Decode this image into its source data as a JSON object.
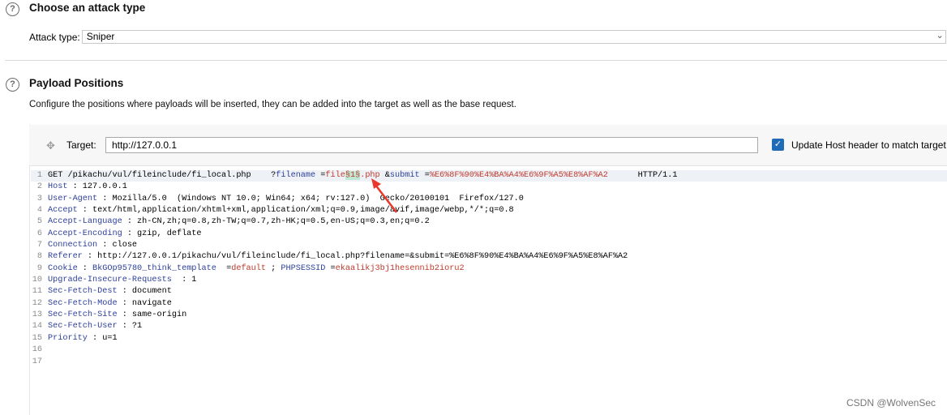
{
  "attack_section": {
    "title": "Choose an attack type",
    "attack_type_label": "Attack type:",
    "attack_type_value": "Sniper"
  },
  "payload_section": {
    "title": "Payload Positions",
    "description": "Configure the positions where payloads will be inserted, they can be added into the target as well as the base request."
  },
  "target": {
    "label": "Target:",
    "value": "http://127.0.0.1",
    "update_host_label": "Update Host header to match target",
    "update_host_checked": true
  },
  "request_lines": [
    {
      "n": "1",
      "parts": [
        {
          "t": "GET /pikachu/vul/fileinclude/fi_local.php    ?"
        },
        {
          "t": "filename",
          "c": "k"
        },
        {
          "t": " ="
        },
        {
          "t": "file",
          "c": "v"
        },
        {
          "t": "§1§",
          "c": "hl"
        },
        {
          "t": ".php ",
          "c": "v"
        },
        {
          "t": "&"
        },
        {
          "t": "submit",
          "c": "k"
        },
        {
          "t": " ="
        },
        {
          "t": "%E6%8F%90%E4%BA%A4%E6%9F%A5%E8%AF%A2",
          "c": "v"
        },
        {
          "t": "      HTTP/1.1"
        }
      ]
    },
    {
      "n": "2",
      "parts": [
        {
          "t": "Host",
          "c": "k"
        },
        {
          "t": " : 127.0.0.1"
        }
      ]
    },
    {
      "n": "3",
      "parts": [
        {
          "t": "User-Agent",
          "c": "k"
        },
        {
          "t": " : Mozilla/5.0  (Windows NT 10.0; Win64; x64; rv:127.0)  Gecko/20100101  Firefox/127.0"
        }
      ]
    },
    {
      "n": "4",
      "parts": [
        {
          "t": "Accept",
          "c": "k"
        },
        {
          "t": " : text/html,application/xhtml+xml,application/xml;q=0.9,image/avif,image/webp,*/*;q=0.8"
        }
      ]
    },
    {
      "n": "5",
      "parts": [
        {
          "t": "Accept-Language",
          "c": "k"
        },
        {
          "t": " : zh-CN,zh;q=0.8,zh-TW;q=0.7,zh-HK;q=0.5,en-US;q=0.3,en;q=0.2"
        }
      ]
    },
    {
      "n": "6",
      "parts": [
        {
          "t": "Accept-Encoding",
          "c": "k"
        },
        {
          "t": " : gzip, deflate"
        }
      ]
    },
    {
      "n": "7",
      "parts": [
        {
          "t": "Connection",
          "c": "k"
        },
        {
          "t": " : close"
        }
      ]
    },
    {
      "n": "8",
      "parts": [
        {
          "t": "Referer",
          "c": "k"
        },
        {
          "t": " : http://127.0.0.1/pikachu/vul/fileinclude/fi_local.php?filename=&submit=%E6%8F%90%E4%BA%A4%E6%9F%A5%E8%AF%A2"
        }
      ]
    },
    {
      "n": "9",
      "parts": [
        {
          "t": "Cookie",
          "c": "k"
        },
        {
          "t": " : "
        },
        {
          "t": "BkGOp95780_think_template",
          "c": "k"
        },
        {
          "t": "  ="
        },
        {
          "t": "default",
          "c": "v"
        },
        {
          "t": " ; "
        },
        {
          "t": "PHPSESSID",
          "c": "k"
        },
        {
          "t": " ="
        },
        {
          "t": "ekaalikj3bj1hesennib2ioru2",
          "c": "v"
        }
      ]
    },
    {
      "n": "10",
      "parts": [
        {
          "t": "Upgrade-Insecure-Requests",
          "c": "k"
        },
        {
          "t": "  : 1"
        }
      ]
    },
    {
      "n": "11",
      "parts": [
        {
          "t": "Sec-Fetch-Dest",
          "c": "k"
        },
        {
          "t": " : document"
        }
      ]
    },
    {
      "n": "12",
      "parts": [
        {
          "t": "Sec-Fetch-Mode",
          "c": "k"
        },
        {
          "t": " : navigate"
        }
      ]
    },
    {
      "n": "13",
      "parts": [
        {
          "t": "Sec-Fetch-Site",
          "c": "k"
        },
        {
          "t": " : same-origin"
        }
      ]
    },
    {
      "n": "14",
      "parts": [
        {
          "t": "Sec-Fetch-User",
          "c": "k"
        },
        {
          "t": " : ?1"
        }
      ]
    },
    {
      "n": "15",
      "parts": [
        {
          "t": "Priority",
          "c": "k"
        },
        {
          "t": " : u=1"
        }
      ]
    },
    {
      "n": "16",
      "parts": []
    },
    {
      "n": "17",
      "parts": []
    }
  ],
  "watermark": "CSDN @WolvenSec",
  "colors": {
    "accent": "#1f6bb8",
    "key": "#2d3f9a",
    "value": "#c0392b",
    "highlight": "#bfe8d5",
    "arrow": "#e8382b"
  }
}
